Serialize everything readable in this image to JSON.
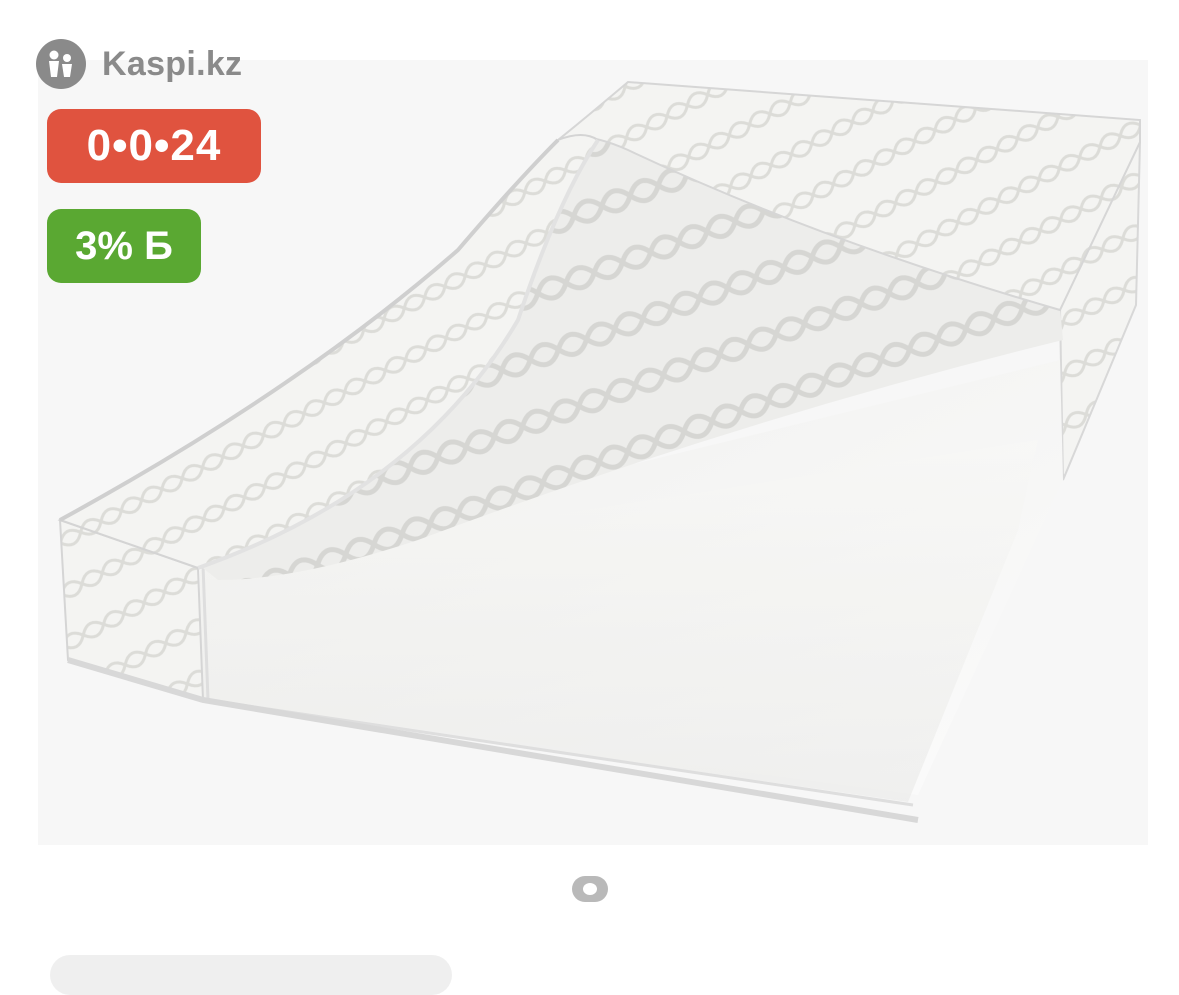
{
  "watermark": {
    "logo_icon": "kaspi-logo-icon",
    "text": "Kaspi.kz"
  },
  "badges": {
    "installment": "0•0•24",
    "bonus": "3% Б"
  },
  "carousel": {
    "current_index": 1,
    "total": 1
  },
  "colors": {
    "installment_badge": "#e0533f",
    "bonus_badge": "#5aa832",
    "watermark_gray": "#8a8a8a"
  }
}
